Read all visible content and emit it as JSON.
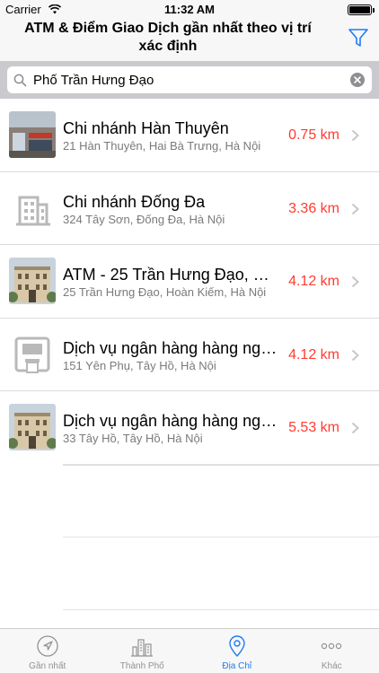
{
  "status_bar": {
    "carrier": "Carrier",
    "time": "11:32 AM",
    "battery_level": 1.0
  },
  "nav": {
    "title": "ATM & Điểm Giao Dịch gần nhất theo vị trí xác định",
    "filter_icon": "filter-icon"
  },
  "search": {
    "value": "Phố Trần Hưng Đạo",
    "placeholder": ""
  },
  "results": [
    {
      "title": "Chi nhánh Hàn Thuyên",
      "address": "21 Hàn Thuyên, Hai Bà Trưng, Hà Nội",
      "distance": "0.75 km",
      "thumb": "branch-photo"
    },
    {
      "title": "Chi nhánh  Đống Đa",
      "address": "324 Tây Sơn, Đống Đa, Hà Nội",
      "distance": "3.36 km",
      "thumb": "building-placeholder"
    },
    {
      "title": "ATM - 25 Trần Hưng Đạo, Ho...",
      "address": "25 Trần Hưng Đạo, Hoàn Kiếm, Hà Nội",
      "distance": "4.12 km",
      "thumb": "building-photo"
    },
    {
      "title": "Dịch vụ ngân hàng hàng ngà...",
      "address": "151 Yên Phụ, Tây Hồ, Hà Nội",
      "distance": "4.12 km",
      "thumb": "atm-placeholder"
    },
    {
      "title": "Dịch vụ ngân hàng hàng ngà...",
      "address": "33 Tây Hồ, Tây Hồ, Hà Nội",
      "distance": "5.53 km",
      "thumb": "building-photo"
    }
  ],
  "tabs": [
    {
      "label": "Gần nhất",
      "icon": "location-arrow-icon",
      "active": false
    },
    {
      "label": "Thành Phố",
      "icon": "city-icon",
      "active": false
    },
    {
      "label": "Địa Chỉ",
      "icon": "map-pin-icon",
      "active": true
    },
    {
      "label": "Khác",
      "icon": "more-icon",
      "active": false
    }
  ],
  "colors": {
    "accent": "#1f7cf6",
    "distance": "#ff3b30",
    "secondary_text": "#7a7a7a"
  }
}
